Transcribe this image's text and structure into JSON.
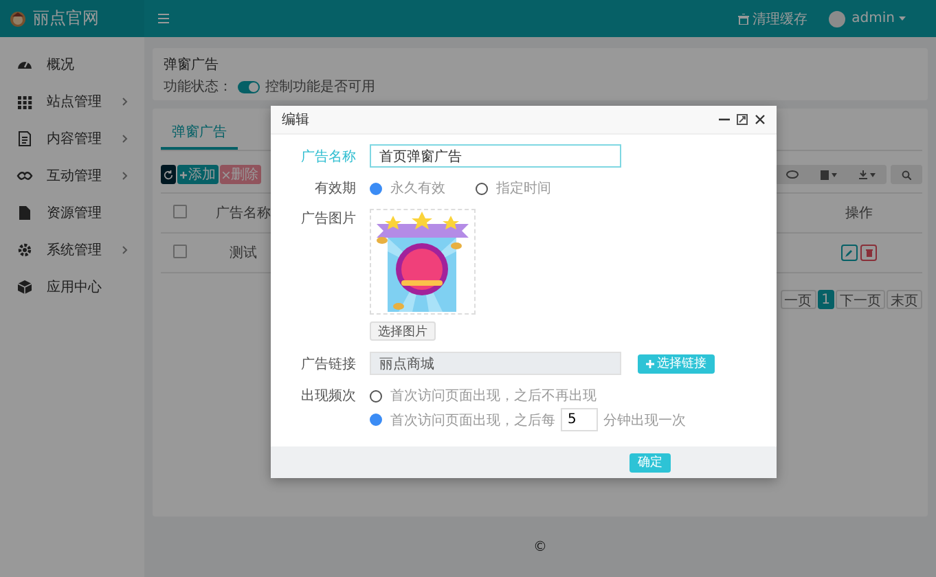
{
  "header": {
    "logo": "丽点官网",
    "clear_cache": "清理缓存",
    "user": "admin"
  },
  "sidebar": {
    "items": [
      {
        "label": "概况",
        "expandable": false
      },
      {
        "label": "站点管理",
        "expandable": true
      },
      {
        "label": "内容管理",
        "expandable": true
      },
      {
        "label": "互动管理",
        "expandable": true
      },
      {
        "label": "资源管理",
        "expandable": false
      },
      {
        "label": "系统管理",
        "expandable": true
      },
      {
        "label": "应用中心",
        "expandable": false
      }
    ]
  },
  "feature_card": {
    "title": "弹窗广告",
    "status_label": "功能状态：",
    "switch_on": true,
    "hint": "控制功能是否可用"
  },
  "list_card": {
    "tabs": [
      {
        "label": "弹窗广告",
        "selected": true
      }
    ],
    "toolbar": {
      "add": "添加",
      "delete": "删除"
    },
    "table": {
      "header_checked": false,
      "columns": [
        "广告名称",
        "操作"
      ],
      "rows": [
        {
          "checked": false,
          "name": "测试"
        }
      ]
    },
    "pagination": [
      {
        "label": "一页",
        "selected": false
      },
      {
        "label": "1",
        "selected": true
      },
      {
        "label": "下一页",
        "selected": false
      },
      {
        "label": "末页",
        "selected": false
      }
    ]
  },
  "footer": {
    "copyright": "©"
  },
  "dialog": {
    "title": "编辑",
    "name": {
      "label": "广告名称",
      "value": "首页弹窗广告"
    },
    "validity": {
      "label": "有效期",
      "options": [
        {
          "label": "永久有效",
          "selected": true
        },
        {
          "label": "指定时间",
          "selected": false
        }
      ]
    },
    "image": {
      "label": "广告图片",
      "kind": "picture",
      "button": "选择图片"
    },
    "link": {
      "label": "广告链接",
      "value": "丽点商城",
      "button": "选择链接"
    },
    "frequency": {
      "label": "出现频次",
      "options": [
        {
          "label": "首次访问页面出现，之后不再出现",
          "selected": false
        },
        {
          "label": "首次访问页面出现，之后每",
          "selected": true,
          "minutes": "5",
          "suffix": "分钟出现一次"
        }
      ]
    },
    "confirm": "确定"
  }
}
